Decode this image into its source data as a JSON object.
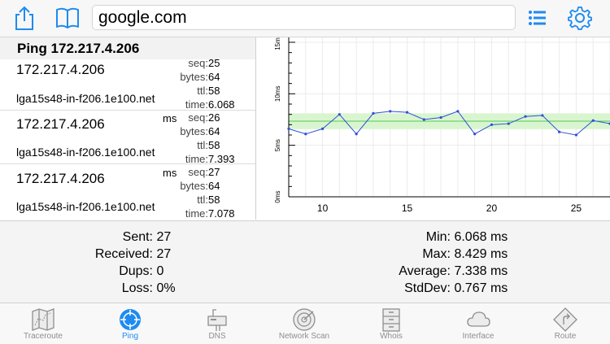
{
  "toolbar": {
    "url": "google.com",
    "share_icon": "share-icon",
    "bookmarks_icon": "book-icon",
    "list_icon": "list-icon",
    "settings_icon": "gear-icon",
    "accent": "#1e8bf0"
  },
  "ping": {
    "title": "Ping 172.217.4.206",
    "rows": [
      {
        "ip": "172.217.4.206",
        "host": "lga15s48-in-f206.1e100.net",
        "seq_label": "seq:",
        "seq": "25",
        "bytes_label": "bytes:",
        "bytes": "64",
        "ttl_label": "ttl:",
        "ttl": "58",
        "time_label": "time:",
        "time": "6.068 ms"
      },
      {
        "ip": "172.217.4.206",
        "host": "lga15s48-in-f206.1e100.net",
        "seq_label": "seq:",
        "seq": "26",
        "bytes_label": "bytes:",
        "bytes": "64",
        "ttl_label": "ttl:",
        "ttl": "58",
        "time_label": "time:",
        "time": "7.393 ms"
      },
      {
        "ip": "172.217.4.206",
        "host": "lga15s48-in-f206.1e100.net",
        "seq_label": "seq:",
        "seq": "27",
        "bytes_label": "bytes:",
        "bytes": "64",
        "ttl_label": "ttl:",
        "ttl": "58",
        "time_label": "time:",
        "time": "7.078 ms"
      }
    ]
  },
  "chart_data": {
    "type": "line",
    "x": [
      8,
      9,
      10,
      11,
      12,
      13,
      14,
      15,
      16,
      17,
      18,
      19,
      20,
      21,
      22,
      23,
      24,
      25,
      26,
      27
    ],
    "values": [
      6.6,
      6.1,
      6.6,
      8.0,
      6.1,
      8.1,
      8.3,
      8.2,
      7.5,
      7.7,
      8.3,
      6.1,
      7.0,
      7.1,
      7.8,
      7.9,
      6.3,
      6.0,
      7.4,
      7.1
    ],
    "xlim": [
      8,
      27
    ],
    "ylim": [
      0,
      15
    ],
    "x_ticks": [
      "10",
      "15",
      "20",
      "25"
    ],
    "y_ticks": [
      "0ms",
      "5ms",
      "10ms",
      "15ms"
    ],
    "average": 7.338,
    "band": [
      6.571,
      8.105
    ],
    "line_color": "#2f4fd8",
    "band_color": "#d9f5d0",
    "avg_color": "#52c952"
  },
  "stats": {
    "sent_label": "Sent:",
    "sent": "27",
    "received_label": "Received:",
    "received": "27",
    "dups_label": "Dups:",
    "dups": "0",
    "loss_label": "Loss:",
    "loss": "0%",
    "min_label": "Min:",
    "min": "6.068 ms",
    "max_label": "Max:",
    "max": "8.429 ms",
    "average_label": "Average:",
    "average": "7.338 ms",
    "stddev_label": "StdDev:",
    "stddev": "0.767 ms"
  },
  "tabs": [
    {
      "label": "Traceroute",
      "icon": "map-icon"
    },
    {
      "label": "Ping",
      "icon": "crosshair-icon",
      "active": true
    },
    {
      "label": "DNS",
      "icon": "mailbox-icon"
    },
    {
      "label": "Network Scan",
      "icon": "radar-icon"
    },
    {
      "label": "Whois",
      "icon": "cabinet-icon"
    },
    {
      "label": "Interface",
      "icon": "cloud-icon"
    },
    {
      "label": "Route",
      "icon": "route-sign-icon"
    }
  ]
}
